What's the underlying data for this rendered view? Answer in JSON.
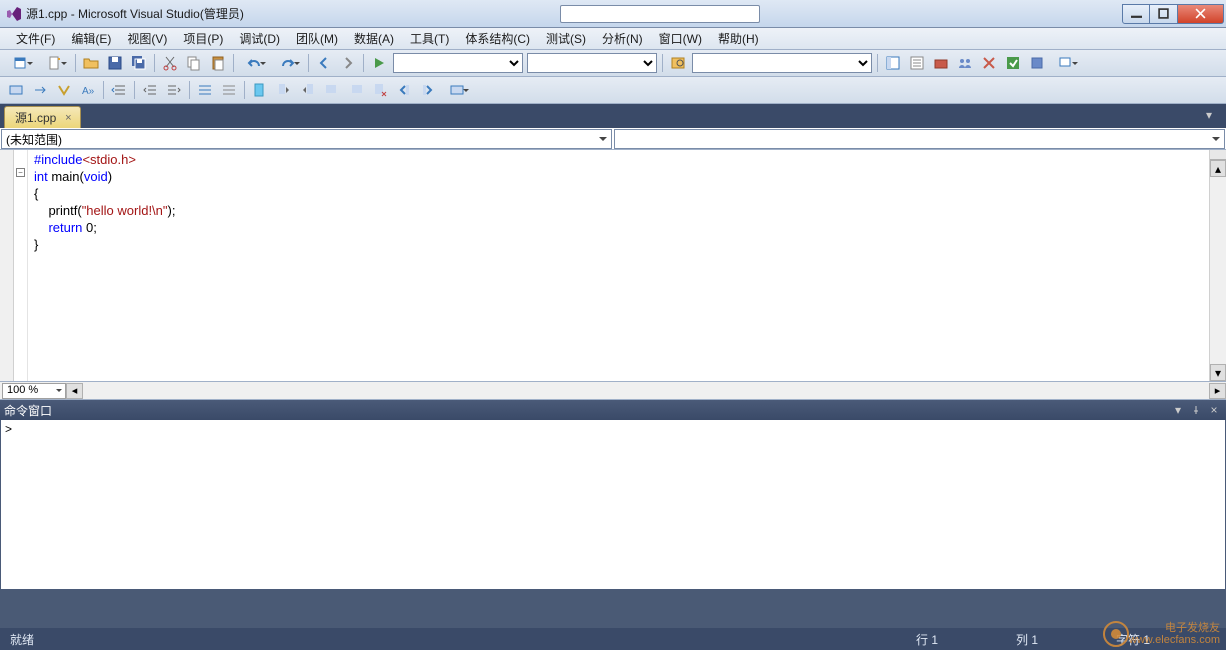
{
  "window": {
    "title": "源1.cpp - Microsoft Visual Studio(管理员)"
  },
  "menu": {
    "items": [
      "文件(F)",
      "编辑(E)",
      "视图(V)",
      "项目(P)",
      "调试(D)",
      "团队(M)",
      "数据(A)",
      "工具(T)",
      "体系结构(C)",
      "测试(S)",
      "分析(N)",
      "窗口(W)",
      "帮助(H)"
    ]
  },
  "tab": {
    "label": "源1.cpp"
  },
  "scope": {
    "left": "(未知范围)",
    "right": ""
  },
  "code": {
    "line1_pp": "#include",
    "line1_hdr": "<stdio.h>",
    "line2a": "int",
    "line2b": " main(",
    "line2c": "void",
    "line2d": ")",
    "line3": "{",
    "line4a": "    printf(",
    "line4b": "\"hello world!\\n\"",
    "line4c": ");",
    "line5a": "    ",
    "line5b": "return",
    "line5c": " 0;",
    "line6": "}"
  },
  "zoom": {
    "value": "100 %"
  },
  "cmdwin": {
    "title": "命令窗口",
    "prompt": ">"
  },
  "status": {
    "ready": "就绪",
    "line_label": "行 1",
    "col_label": "列 1",
    "char_label": "字符 1"
  },
  "watermark": {
    "l1": "电子发烧友",
    "l2": "www.elecfans.com"
  }
}
